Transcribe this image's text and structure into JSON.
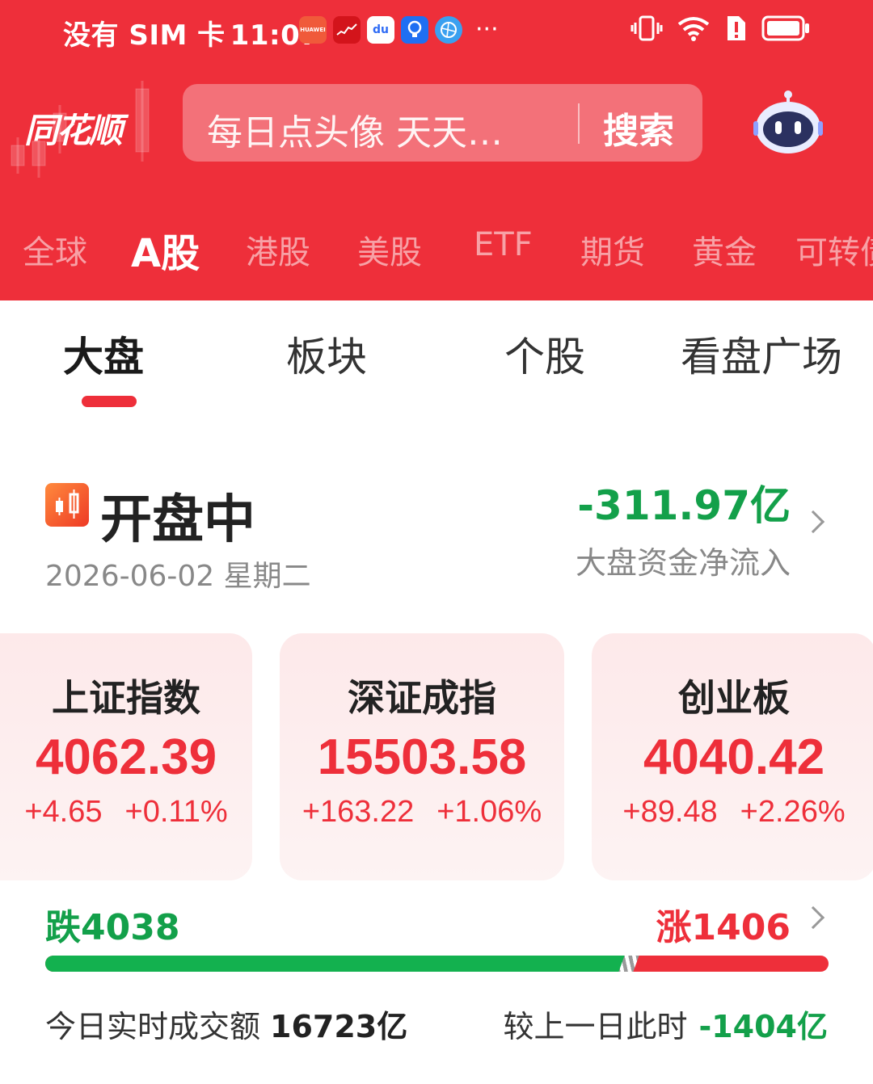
{
  "statusbar": {
    "carrier": "没有 SIM 卡",
    "time": "11:07",
    "apps": [
      {
        "name": "huawei-app-icon",
        "label": "HUAWEI",
        "bg": "#f05a3a"
      },
      {
        "name": "stock-app-icon",
        "label": "",
        "bg": "#d3141b"
      },
      {
        "name": "baidu-app-icon",
        "label": "du",
        "bg": "#2f6cf5"
      },
      {
        "name": "bulb-app-icon",
        "label": "",
        "bg": "#1f6ff2"
      },
      {
        "name": "browser-app-icon",
        "label": "",
        "bg": "#3aa0f0"
      }
    ],
    "more": "···"
  },
  "header": {
    "logo": "同花顺",
    "search_placeholder": "每日点头像 天天…",
    "search_button": "搜索"
  },
  "market_tabs": [
    "全球",
    "A股",
    "港股",
    "美股",
    "ETF",
    "期货",
    "黄金",
    "可转债"
  ],
  "market_tabs_active": 1,
  "sub_tabs": [
    "大盘",
    "板块",
    "个股",
    "看盘广场"
  ],
  "status": {
    "title": "开盘中",
    "date": "2026-06-02 星期二",
    "flow_value": "-311.97亿",
    "flow_label": "大盘资金净流入"
  },
  "indices": [
    {
      "name": "上证指数",
      "value": "4062.39",
      "change": "+4.65",
      "percent": "+0.11%"
    },
    {
      "name": "深证成指",
      "value": "15503.58",
      "change": "+163.22",
      "percent": "+1.06%"
    },
    {
      "name": "创业板",
      "value": "4040.42",
      "change": "+89.48",
      "percent": "+2.26%"
    }
  ],
  "breadth": {
    "fall_label": "跌4038",
    "rise_label": "涨1406",
    "fall_count": 4038,
    "rise_count": 1406
  },
  "turnover": {
    "label": "今日实时成交额",
    "value": "16723亿",
    "compare_label": "较上一日此时",
    "compare_value": "-1404亿"
  },
  "colors": {
    "brand_red": "#ee2f3a",
    "down_green": "#13a04a",
    "up_red": "#ee2f3a"
  }
}
